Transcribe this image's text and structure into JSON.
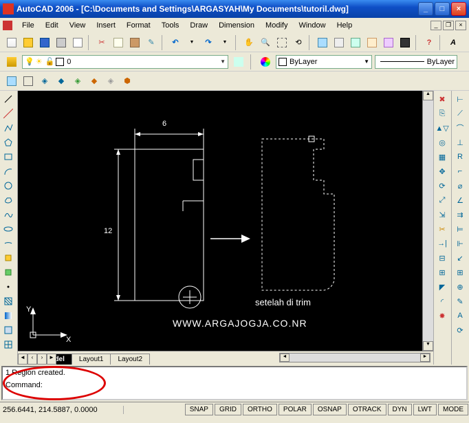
{
  "window": {
    "app_name": "AutoCAD 2006",
    "doc_path": "[C:\\Documents and Settings\\ARGASYAH\\My Documents\\tutoril.dwg]",
    "full_title": "AutoCAD 2006 - [C:\\Documents and Settings\\ARGASYAH\\My Documents\\tutoril.dwg]"
  },
  "menu": {
    "file": "File",
    "edit": "Edit",
    "view": "View",
    "insert": "Insert",
    "format": "Format",
    "tools": "Tools",
    "draw": "Draw",
    "dimension": "Dimension",
    "modify": "Modify",
    "window": "Window",
    "help": "Help"
  },
  "layers": {
    "current": "0",
    "color_prop": "ByLayer",
    "linetype_prop": "ByLayer"
  },
  "tabs": {
    "model": "Model",
    "layout1": "Layout1",
    "layout2": "Layout2"
  },
  "command": {
    "line1": "1 Region created.",
    "prompt": "Command:"
  },
  "status": {
    "coords": "256.6441, 214.5887, 0.0000",
    "snap": "SNAP",
    "grid": "GRID",
    "ortho": "ORTHO",
    "polar": "POLAR",
    "osnap": "OSNAP",
    "otrack": "OTRACK",
    "dyn": "DYN",
    "lwt": "LWT",
    "model": "MODE"
  },
  "drawing": {
    "dim_width": "6",
    "dim_height": "12",
    "annotation": "setelah di trim",
    "url": "WWW.ARGAJOGJA.CO.NR",
    "ucs_x": "X",
    "ucs_y": "Y"
  }
}
